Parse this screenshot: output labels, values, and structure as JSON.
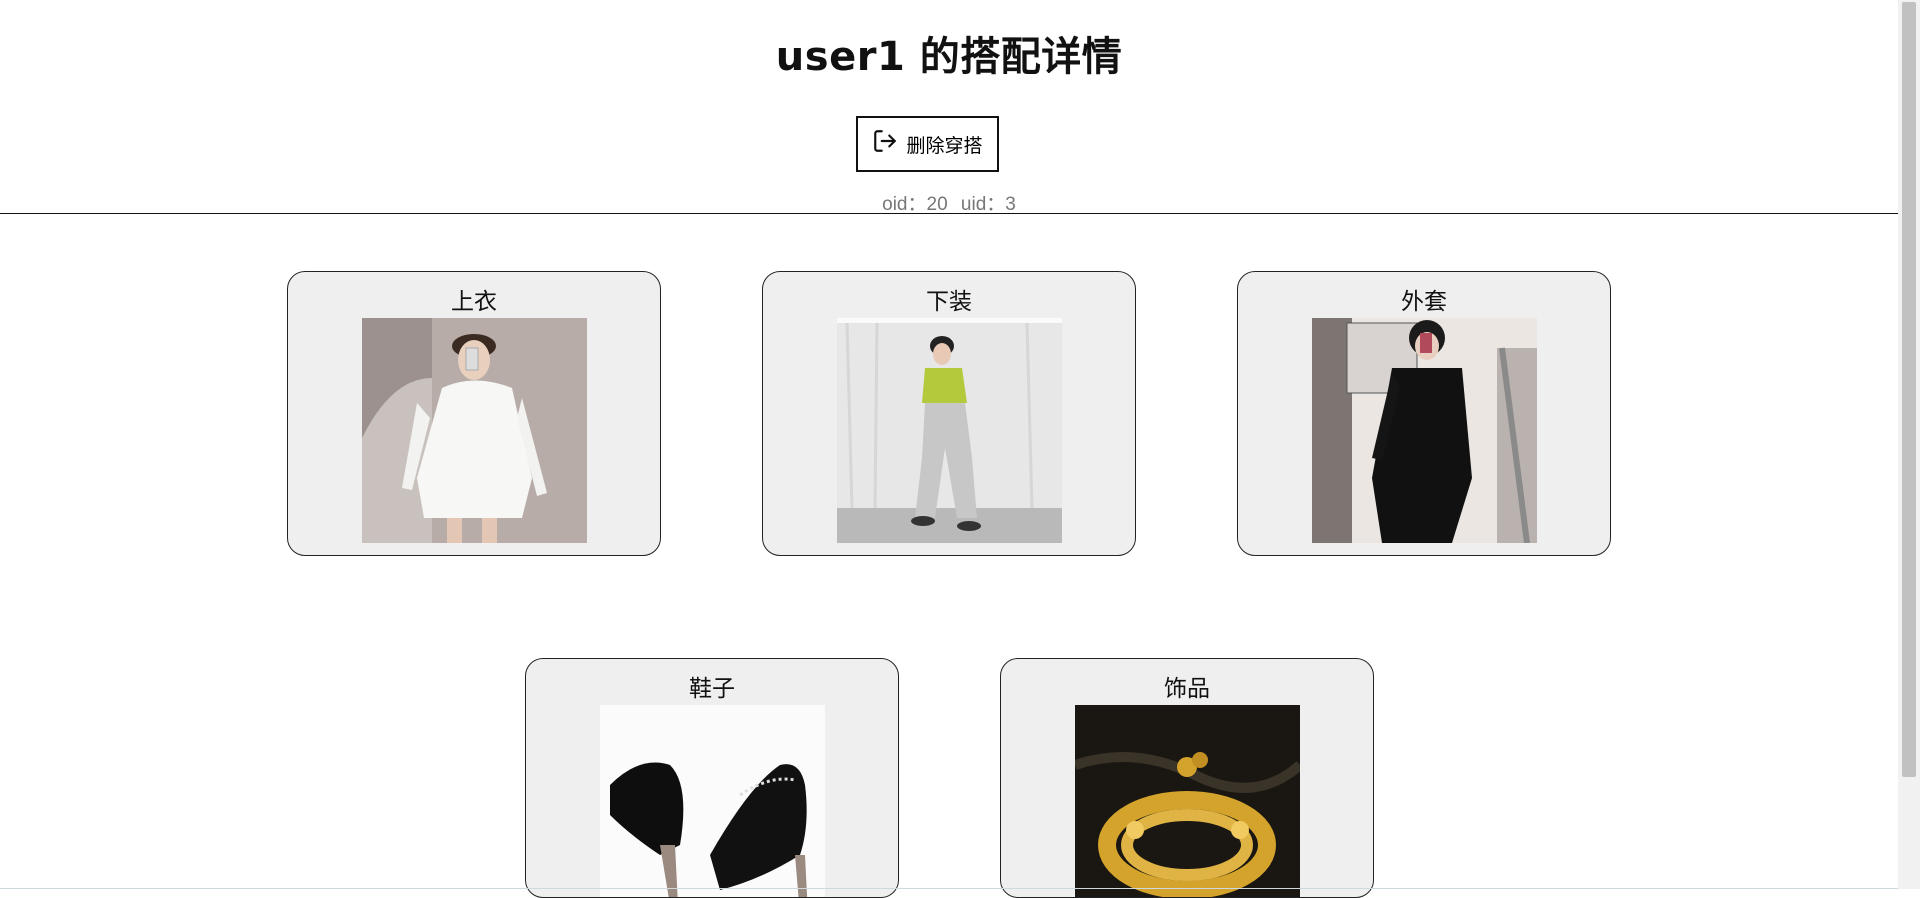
{
  "page": {
    "title": "user1 的搭配详情",
    "delete_button": {
      "label": "删除穿搭",
      "icon": "logout-icon"
    },
    "meta": {
      "oid": "oid：20",
      "uid": "uid：3"
    }
  },
  "outfit_items": [
    {
      "category": "上衣",
      "image": "white long-sleeve top photo"
    },
    {
      "category": "下装",
      "image": "grey jogger pants photo"
    },
    {
      "category": "外套",
      "image": "black coat photo"
    },
    {
      "category": "鞋子",
      "image": "black high-heel shoes photo"
    },
    {
      "category": "饰品",
      "image": "gold bead bracelet photo"
    }
  ],
  "colors": {
    "card_bg": "#efefef",
    "border": "#222222",
    "meta_text": "#777777"
  }
}
